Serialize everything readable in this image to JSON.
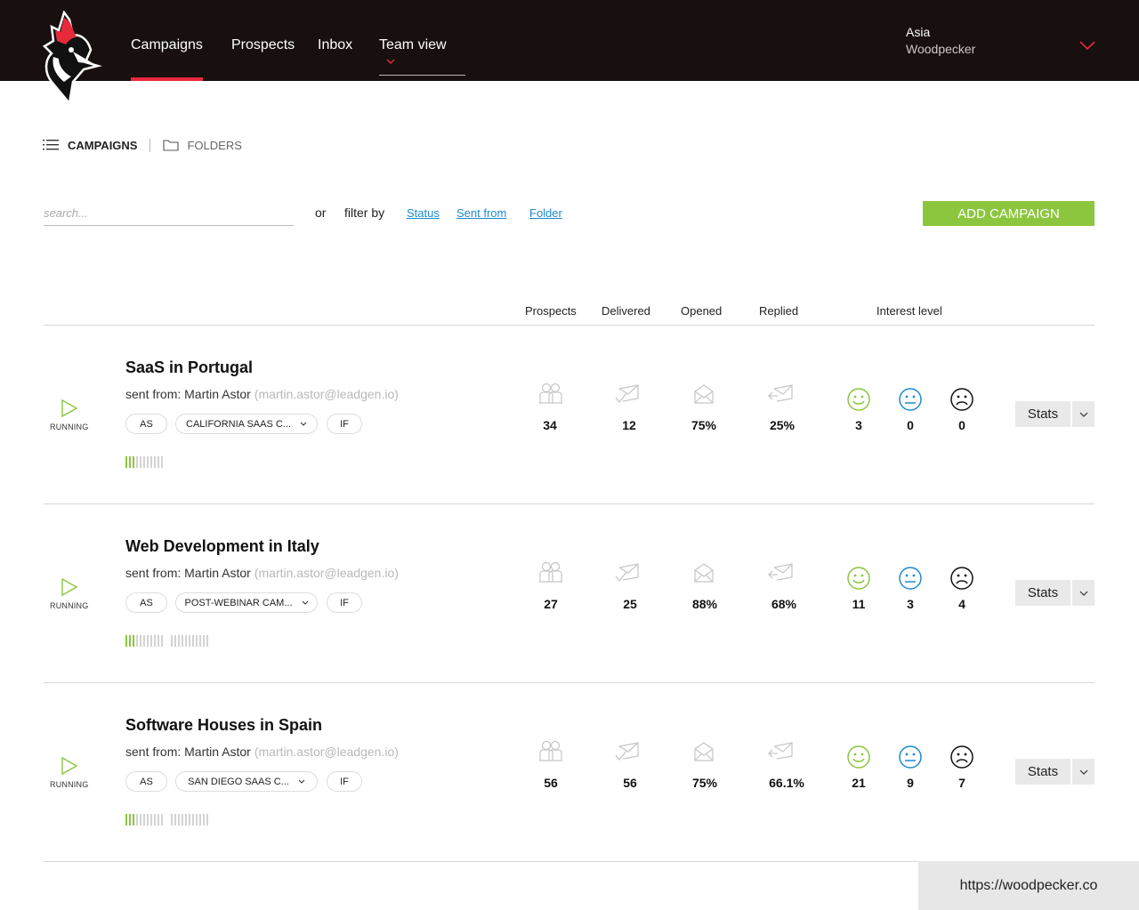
{
  "nav": {
    "items": [
      {
        "label": "Campaigns",
        "active": true
      },
      {
        "label": "Prospects"
      },
      {
        "label": "Inbox"
      },
      {
        "label": "Team view"
      }
    ]
  },
  "user": {
    "first": "Asia",
    "last": "Woodpecker"
  },
  "view_tabs": {
    "campaigns": "CAMPAIGNS",
    "folders": "FOLDERS"
  },
  "search": {
    "placeholder": "search..."
  },
  "filter": {
    "or": "or",
    "label": "filter by",
    "links": [
      "Status",
      "Sent from",
      "Folder"
    ]
  },
  "add_button": "ADD CAMPAIGN",
  "columns": {
    "prospects": "Prospects",
    "delivered": "Delivered",
    "opened": "Opened",
    "replied": "Replied",
    "interest": "Interest level"
  },
  "colors": {
    "accent_red": "#e8293b",
    "green": "#8cc63f",
    "neutral_blue": "#1c8ad1",
    "header_bg": "#180f0f"
  },
  "campaigns": [
    {
      "title": "SaaS in Portugal",
      "sent_from_prefix": "sent from: Martin Astor",
      "sent_from_email": "(martin.astor@leadgen.io)",
      "status": "RUNNING",
      "pills": [
        "AS",
        "CALIFORNIA SAAS C...",
        "IF"
      ],
      "prospects": "34",
      "delivered": "12",
      "opened": "75%",
      "replied": "25%",
      "interest": {
        "happy": "3",
        "neutral": "0",
        "sad": "0"
      },
      "stats_label": "Stats"
    },
    {
      "title": "Web Development in Italy",
      "sent_from_prefix": "sent from: Martin Astor",
      "sent_from_email": "(martin.astor@leadgen.io)",
      "status": "RUNNING",
      "pills": [
        "AS",
        "POST-WEBINAR CAM...",
        "IF"
      ],
      "prospects": "27",
      "delivered": "25",
      "opened": "88%",
      "replied": "68%",
      "interest": {
        "happy": "11",
        "neutral": "3",
        "sad": "4"
      },
      "stats_label": "Stats"
    },
    {
      "title": "Software Houses in Spain",
      "sent_from_prefix": "sent from: Martin Astor",
      "sent_from_email": "(martin.astor@leadgen.io)",
      "status": "RUNNING",
      "pills": [
        "AS",
        "SAN DIEGO SAAS C...",
        "IF"
      ],
      "prospects": "56",
      "delivered": "56",
      "opened": "75%",
      "replied": "66.1%",
      "interest": {
        "happy": "21",
        "neutral": "9",
        "sad": "7"
      },
      "stats_label": "Stats"
    }
  ],
  "footer": {
    "url": "https://woodpecker.co"
  }
}
